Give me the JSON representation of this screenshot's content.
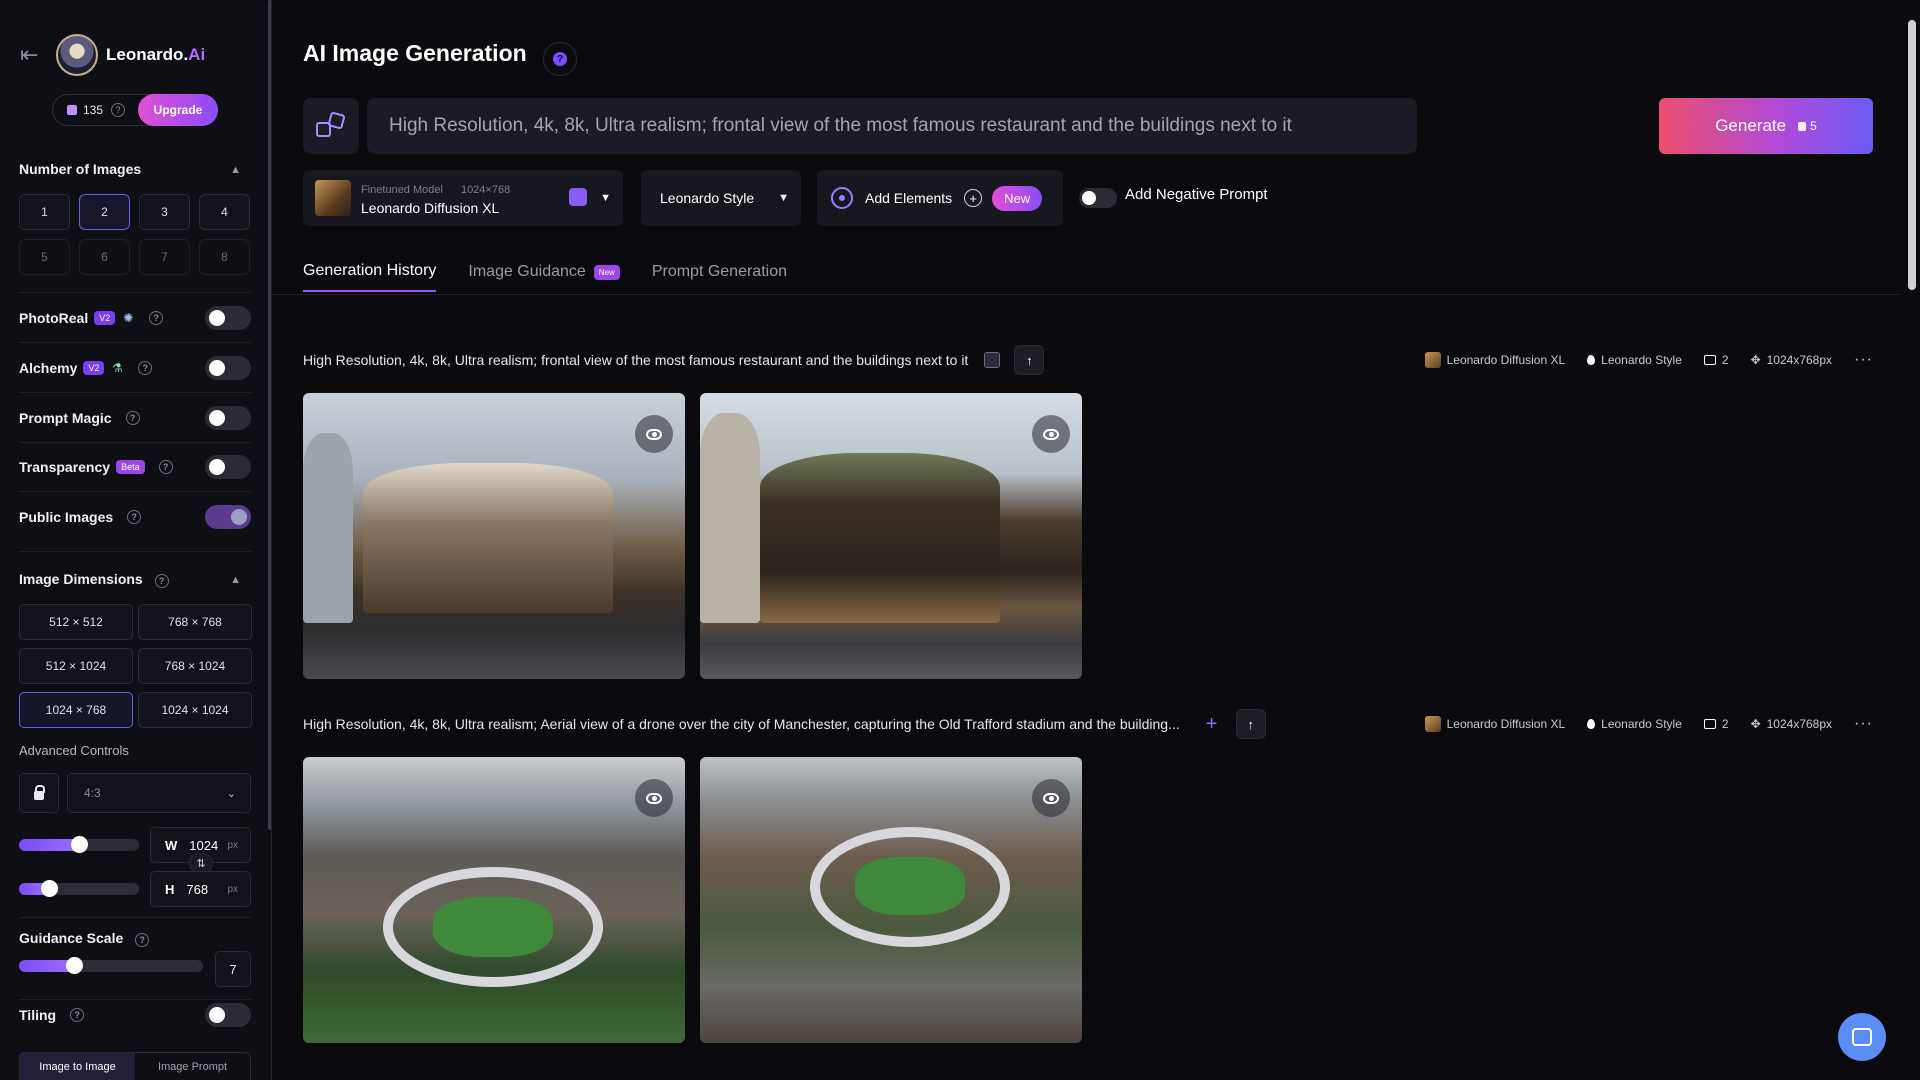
{
  "brand": {
    "name_main": "Leonardo.",
    "name_accent": "Ai"
  },
  "credits": {
    "count": "135",
    "upgrade_label": "Upgrade"
  },
  "sidebar": {
    "num_images_title": "Number of Images",
    "num_options": [
      "1",
      "2",
      "3",
      "4",
      "5",
      "6",
      "7",
      "8"
    ],
    "num_selected": "2",
    "photoreal": {
      "label": "PhotoReal",
      "badge": "V2"
    },
    "alchemy": {
      "label": "Alchemy",
      "badge": "V2"
    },
    "prompt_magic": {
      "label": "Prompt Magic"
    },
    "transparency": {
      "label": "Transparency",
      "badge": "Beta"
    },
    "public_images": {
      "label": "Public Images"
    },
    "dimensions_title": "Image Dimensions",
    "dimension_options": [
      "512 × 512",
      "768 × 768",
      "512 × 1024",
      "768 × 1024",
      "1024 × 768",
      "1024 × 1024"
    ],
    "dimension_selected": "1024 × 768",
    "advanced_label": "Advanced Controls",
    "aspect_ratio": "4:3",
    "width": {
      "key": "W",
      "value": "1024",
      "unit": "px",
      "level": 0.5
    },
    "height": {
      "key": "H",
      "value": "768",
      "unit": "px",
      "level": 0.25
    },
    "guidance": {
      "label": "Guidance Scale",
      "value": "7",
      "level": 0.3
    },
    "tiling": {
      "label": "Tiling"
    },
    "mode_tabs": [
      "Image to Image",
      "Image Prompt"
    ]
  },
  "header": {
    "title": "AI Image Generation",
    "prompt": "High Resolution, 4k, 8k, Ultra realism; frontal view of the most famous restaurant and the buildings next to it",
    "generate_label": "Generate",
    "generate_cost": "5"
  },
  "controls": {
    "model_sub": "Finetuned Model",
    "model_res": "1024×768",
    "model_name": "Leonardo Diffusion XL",
    "style": "Leonardo Style",
    "elements_label": "Add Elements",
    "elements_badge": "New",
    "negative_label": "Add Negative Prompt"
  },
  "tabs": [
    {
      "label": "Generation History",
      "active": true
    },
    {
      "label": "Image Guidance",
      "badge": "New"
    },
    {
      "label": "Prompt Generation"
    }
  ],
  "generations": [
    {
      "prompt": "High Resolution, 4k, 8k, Ultra realism; frontal view of the most famous restaurant and the buildings next to it",
      "model": "Leonardo Diffusion XL",
      "style": "Leonardo Style",
      "count": "2",
      "size": "1024x768px"
    },
    {
      "prompt": "High Resolution, 4k, 8k, Ultra realism; Aerial view of a drone over the city of Manchester, capturing the Old Trafford stadium and the building...",
      "model": "Leonardo Diffusion XL",
      "style": "Leonardo Style",
      "count": "2",
      "size": "1024x768px"
    }
  ],
  "colors": {
    "accent": "#8b5cf6",
    "generate_start": "#ec4e6e",
    "generate_end": "#6b5cf6",
    "chat": "#5b8df6"
  }
}
